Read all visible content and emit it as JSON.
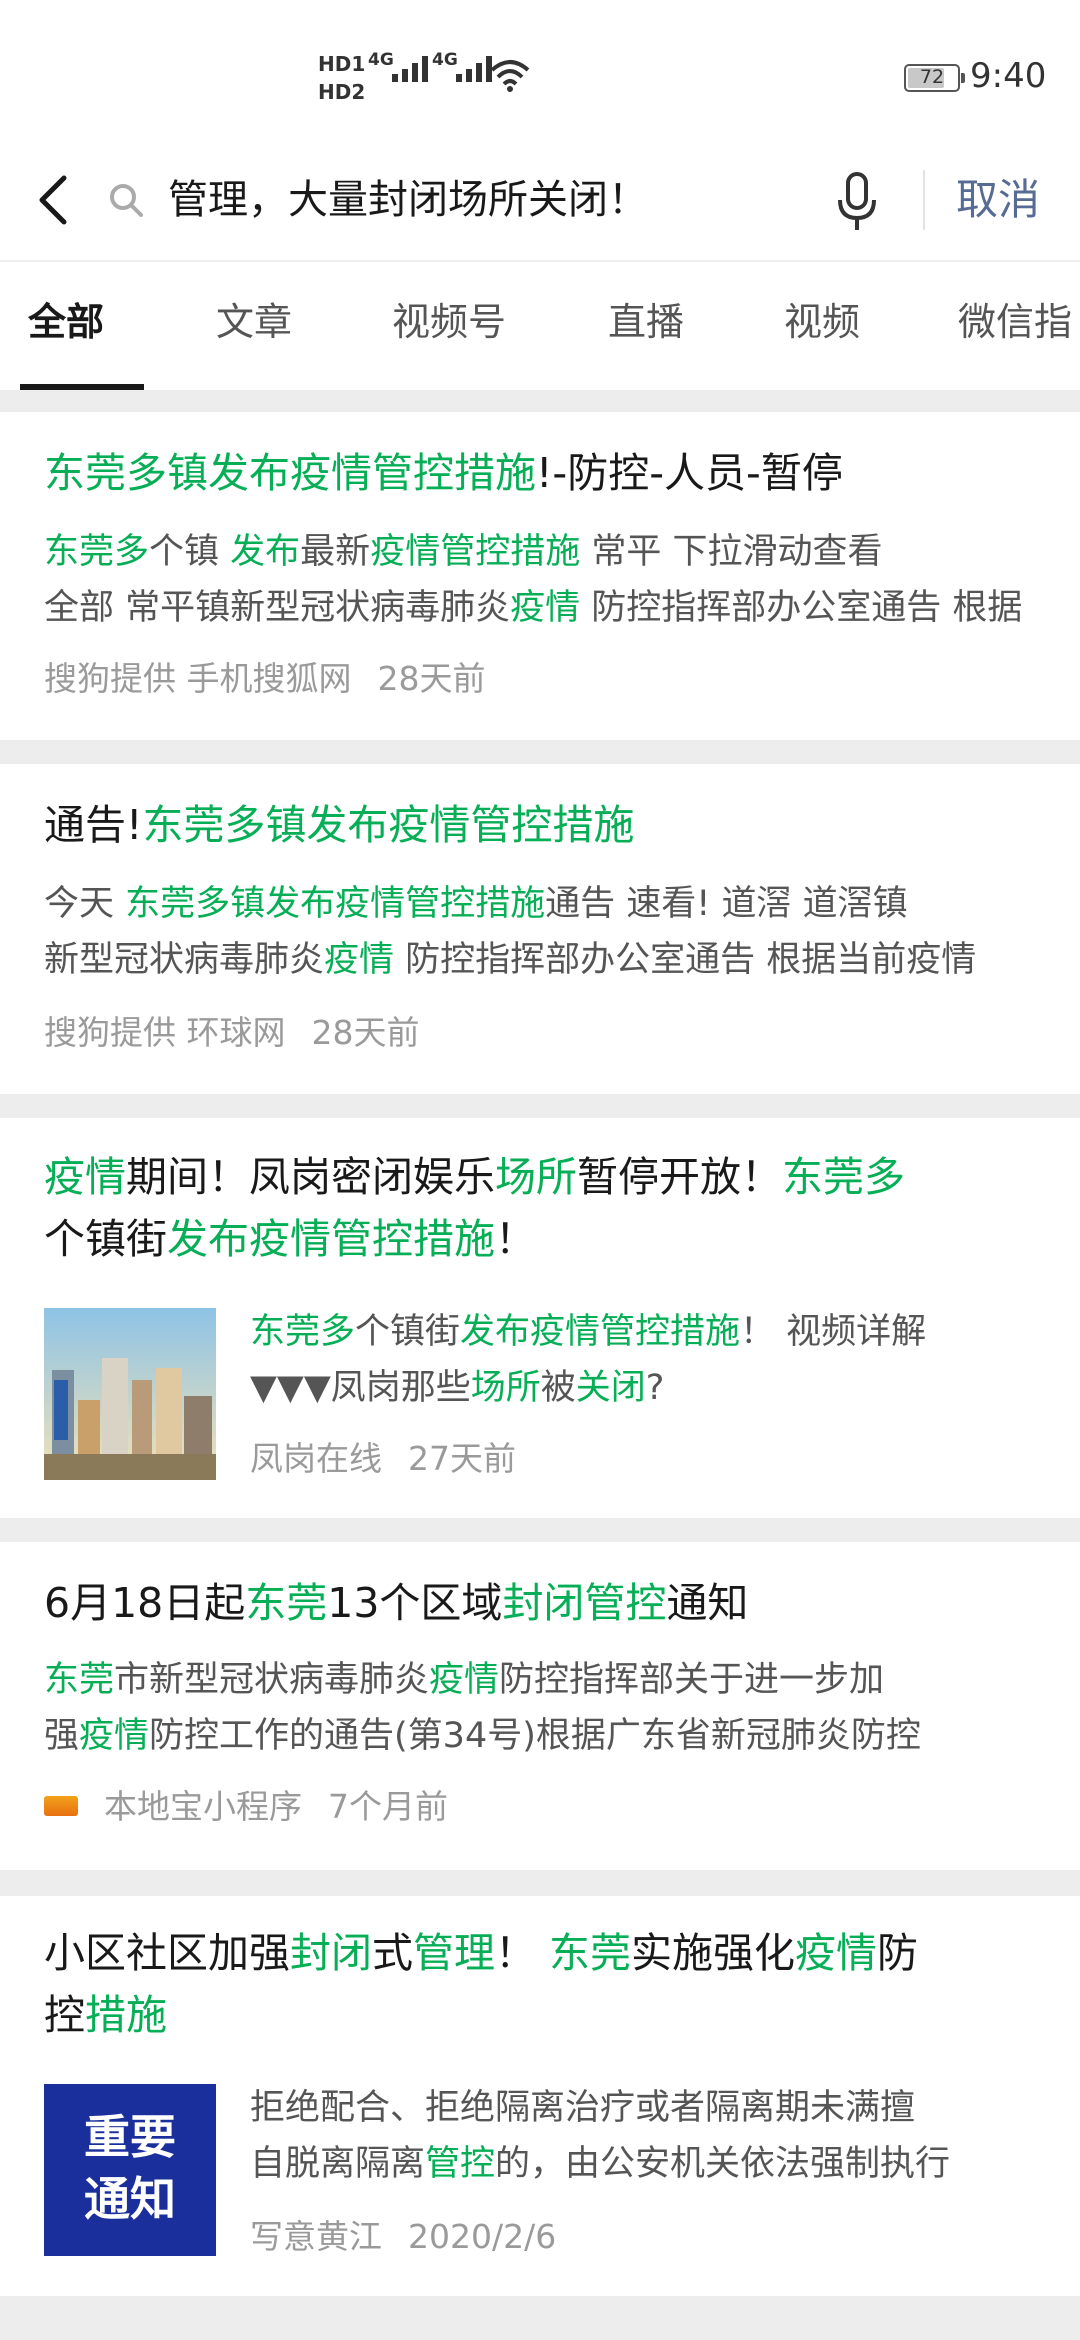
{
  "status_bar": {
    "hd1": "HD1",
    "hd2": "HD2",
    "net1": "4G",
    "net2": "4G",
    "battery": "72",
    "time": "9:40"
  },
  "search": {
    "query": "管理，大量封闭场所关闭！",
    "cancel_label": "取消"
  },
  "tabs": [
    {
      "label": "全部",
      "active": true
    },
    {
      "label": "文章"
    },
    {
      "label": "视频号"
    },
    {
      "label": "直播"
    },
    {
      "label": "视频"
    },
    {
      "label": "微信指"
    }
  ],
  "results": [
    {
      "title": [
        {
          "t": "东莞多镇发布疫情管控措施",
          "h": true
        },
        {
          "t": "!-防控-人员-暂停"
        }
      ],
      "desc": [
        [
          {
            "t": "东莞多",
            "h": true
          },
          {
            "t": "个镇 "
          },
          {
            "t": "发布",
            "h": true
          },
          {
            "t": "最新"
          },
          {
            "t": "疫情管控措施",
            "h": true
          },
          {
            "t": " 常平 下拉滑动查看"
          }
        ],
        [
          {
            "t": "全部 常平镇新型冠状病毒肺炎"
          },
          {
            "t": "疫情",
            "h": true
          },
          {
            "t": " 防控指挥部办公室通告 根据"
          }
        ]
      ],
      "source": "搜狗提供 手机搜狐网",
      "time": "28天前"
    },
    {
      "title": [
        {
          "t": "通告!"
        },
        {
          "t": "东莞多镇发布疫情管控措施",
          "h": true
        }
      ],
      "desc": [
        [
          {
            "t": "今天 "
          },
          {
            "t": "东莞多镇发布疫情管控措施",
            "h": true
          },
          {
            "t": "通告 速看! 道滘 道滘镇"
          }
        ],
        [
          {
            "t": "新型冠状病毒肺炎"
          },
          {
            "t": "疫情",
            "h": true
          },
          {
            "t": " 防控指挥部办公室通告 根据当前疫情"
          }
        ]
      ],
      "source": "搜狗提供 环球网",
      "time": "28天前"
    },
    {
      "title": [
        {
          "t": "疫情",
          "h": true
        },
        {
          "t": "期间！凤岗密闭娱乐"
        },
        {
          "t": "场所",
          "h": true
        },
        {
          "t": "暂停开放！"
        },
        {
          "t": "东莞多",
          "h": true
        },
        {
          "br": true
        },
        {
          "t": "个镇街"
        },
        {
          "t": "发布疫情管控措施",
          "h": true
        },
        {
          "t": "！"
        }
      ],
      "desc": [
        [
          {
            "t": "东莞多",
            "h": true
          },
          {
            "t": "个镇街"
          },
          {
            "t": "发布疫情管控措施",
            "h": true
          },
          {
            "t": "！ 视频详解"
          }
        ],
        [
          {
            "t": "▼▼▼凤岗那些"
          },
          {
            "t": "场所",
            "h": true
          },
          {
            "t": "被"
          },
          {
            "t": "关闭",
            "h": true
          },
          {
            "t": "?"
          }
        ]
      ],
      "source": "凤岗在线",
      "time": "27天前"
    },
    {
      "title": [
        {
          "t": "6月18日起"
        },
        {
          "t": "东莞",
          "h": true
        },
        {
          "t": "13个区域"
        },
        {
          "t": "封闭管控",
          "h": true
        },
        {
          "t": "通知"
        }
      ],
      "desc": [
        [
          {
            "t": "东莞",
            "h": true
          },
          {
            "t": "市新型冠状病毒肺炎"
          },
          {
            "t": "疫情",
            "h": true
          },
          {
            "t": "防控指挥部关于进一步加"
          }
        ],
        [
          {
            "t": "强"
          },
          {
            "t": "疫情",
            "h": true
          },
          {
            "t": "防控工作的通告(第34号)根据广东省新冠肺炎防控"
          }
        ]
      ],
      "source": "本地宝小程序",
      "time": "7个月前"
    },
    {
      "title": [
        {
          "t": "小区社区加强"
        },
        {
          "t": "封闭",
          "h": true
        },
        {
          "t": "式"
        },
        {
          "t": "管理",
          "h": true
        },
        {
          "t": "！ "
        },
        {
          "t": "东莞",
          "h": true
        },
        {
          "t": "实施强化"
        },
        {
          "t": "疫情",
          "h": true
        },
        {
          "t": "防"
        },
        {
          "br": true
        },
        {
          "t": "控"
        },
        {
          "t": "措施",
          "h": true
        }
      ],
      "desc": [
        [
          {
            "t": "拒绝配合、拒绝隔离治疗或者隔离期未满擅"
          }
        ],
        [
          {
            "t": "自脱离隔离"
          },
          {
            "t": "管控",
            "h": true
          },
          {
            "t": "的，由公安机关依法强制执行"
          }
        ]
      ],
      "thumb_text": [
        "重要",
        "通知"
      ],
      "source": "写意黄江",
      "time": "2020/2/6"
    }
  ],
  "colors": {
    "highlight": "#06ae56",
    "link": "#576b95",
    "text": "#191919",
    "secondary": "#9a9a9a",
    "background": "#ededed"
  }
}
